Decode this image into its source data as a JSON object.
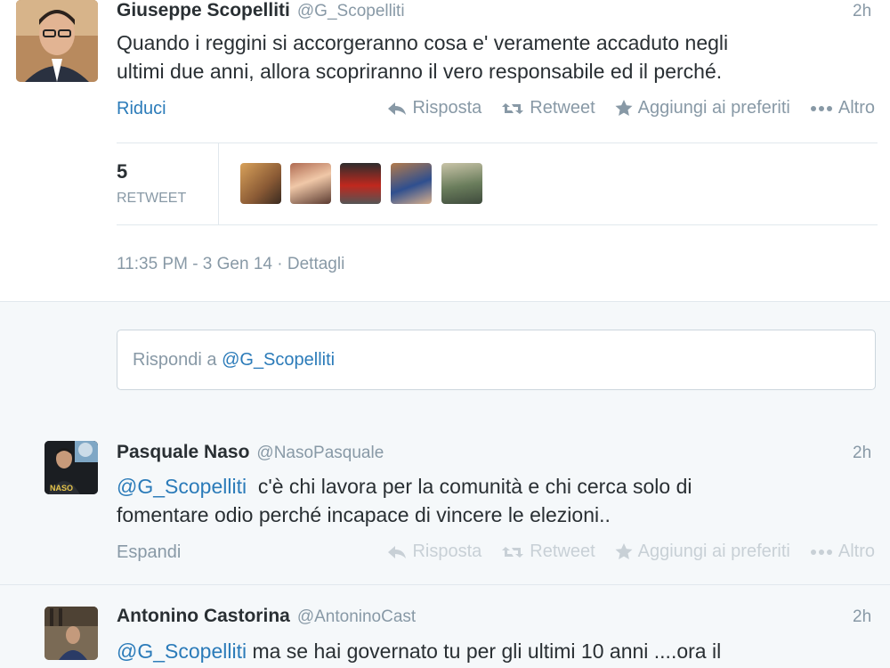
{
  "main_tweet": {
    "author_name": "Giuseppe Scopelliti",
    "handle": "@G_Scopelliti",
    "time": "2h",
    "text_line1": "Quando i reggini si accorgeranno cosa e' veramente accaduto negli",
    "text_line2": "ultimi due anni, allora scopriranno il vero responsabile ed il perché.",
    "collapse_label": "Riduci",
    "actions": {
      "reply": "Risposta",
      "retweet": "Retweet",
      "favorite": "Aggiungi ai preferiti",
      "more": "Altro"
    },
    "retweet_count": "5",
    "retweet_label": "RETWEET",
    "timestamp": "11:35 PM - 3 Gen 14",
    "separator": "·",
    "details_label": "Dettagli"
  },
  "reply_box": {
    "prefix": "Rispondi a",
    "mention": "@G_Scopelliti"
  },
  "replies": [
    {
      "author_name": "Pasquale Naso",
      "handle": "@NasoPasquale",
      "time": "2h",
      "mention": "@G_Scopelliti",
      "text_line1": "  c'è chi lavora per la comunità e chi cerca solo di",
      "text_line2": "fomentare odio perché incapace di vincere le elezioni..",
      "expand_label": "Espandi",
      "actions": {
        "reply": "Risposta",
        "retweet": "Retweet",
        "favorite": "Aggiungi ai preferiti",
        "more": "Altro"
      }
    },
    {
      "author_name": "Antonino Castorina",
      "handle": "@AntoninoCast",
      "time": "2h",
      "mention": "@G_Scopelliti",
      "text_line1": " ma se hai governato tu per gli ultimi 10 anni ....ora il"
    }
  ],
  "colors": {
    "link": "#2b7bb9",
    "muted": "#8899a6",
    "text": "#292f33",
    "gray_bg": "#f5f8fa"
  }
}
